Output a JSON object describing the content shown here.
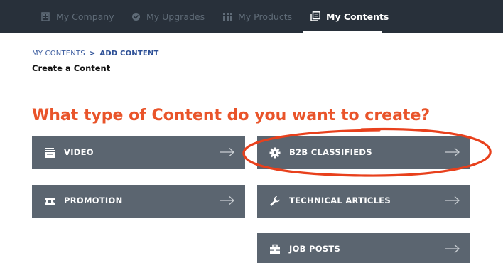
{
  "nav": {
    "items": [
      {
        "label": "My Company",
        "icon": "building-icon"
      },
      {
        "label": "My Upgrades",
        "icon": "badge-check-icon"
      },
      {
        "label": "My Products",
        "icon": "grid-icon"
      },
      {
        "label": "My Contents",
        "icon": "stacked-pages-icon",
        "active": true
      }
    ]
  },
  "breadcrumb": {
    "parent": "MY CONTENTS",
    "separator": ">",
    "current": "ADD CONTENT"
  },
  "subtitle": "Create a Content",
  "headline": "What type of Content do you want to create?",
  "content_types": {
    "video": {
      "label": "VIDEO",
      "icon": "video-icon"
    },
    "promotion": {
      "label": "PROMOTION",
      "icon": "ticket-icon"
    },
    "b2b": {
      "label": "B2B CLASSIFIEDS",
      "icon": "gear-icon"
    },
    "tech": {
      "label": "TECHNICAL ARTICLES",
      "icon": "wrench-icon"
    },
    "job": {
      "label": "JOB POSTS",
      "icon": "briefcase-icon"
    }
  },
  "colors": {
    "nav_bg": "#28303a",
    "tile_bg": "#5b6570",
    "headline": "#e9542a",
    "annotation": "#e8401c",
    "breadcrumb": "#2c4f96"
  }
}
